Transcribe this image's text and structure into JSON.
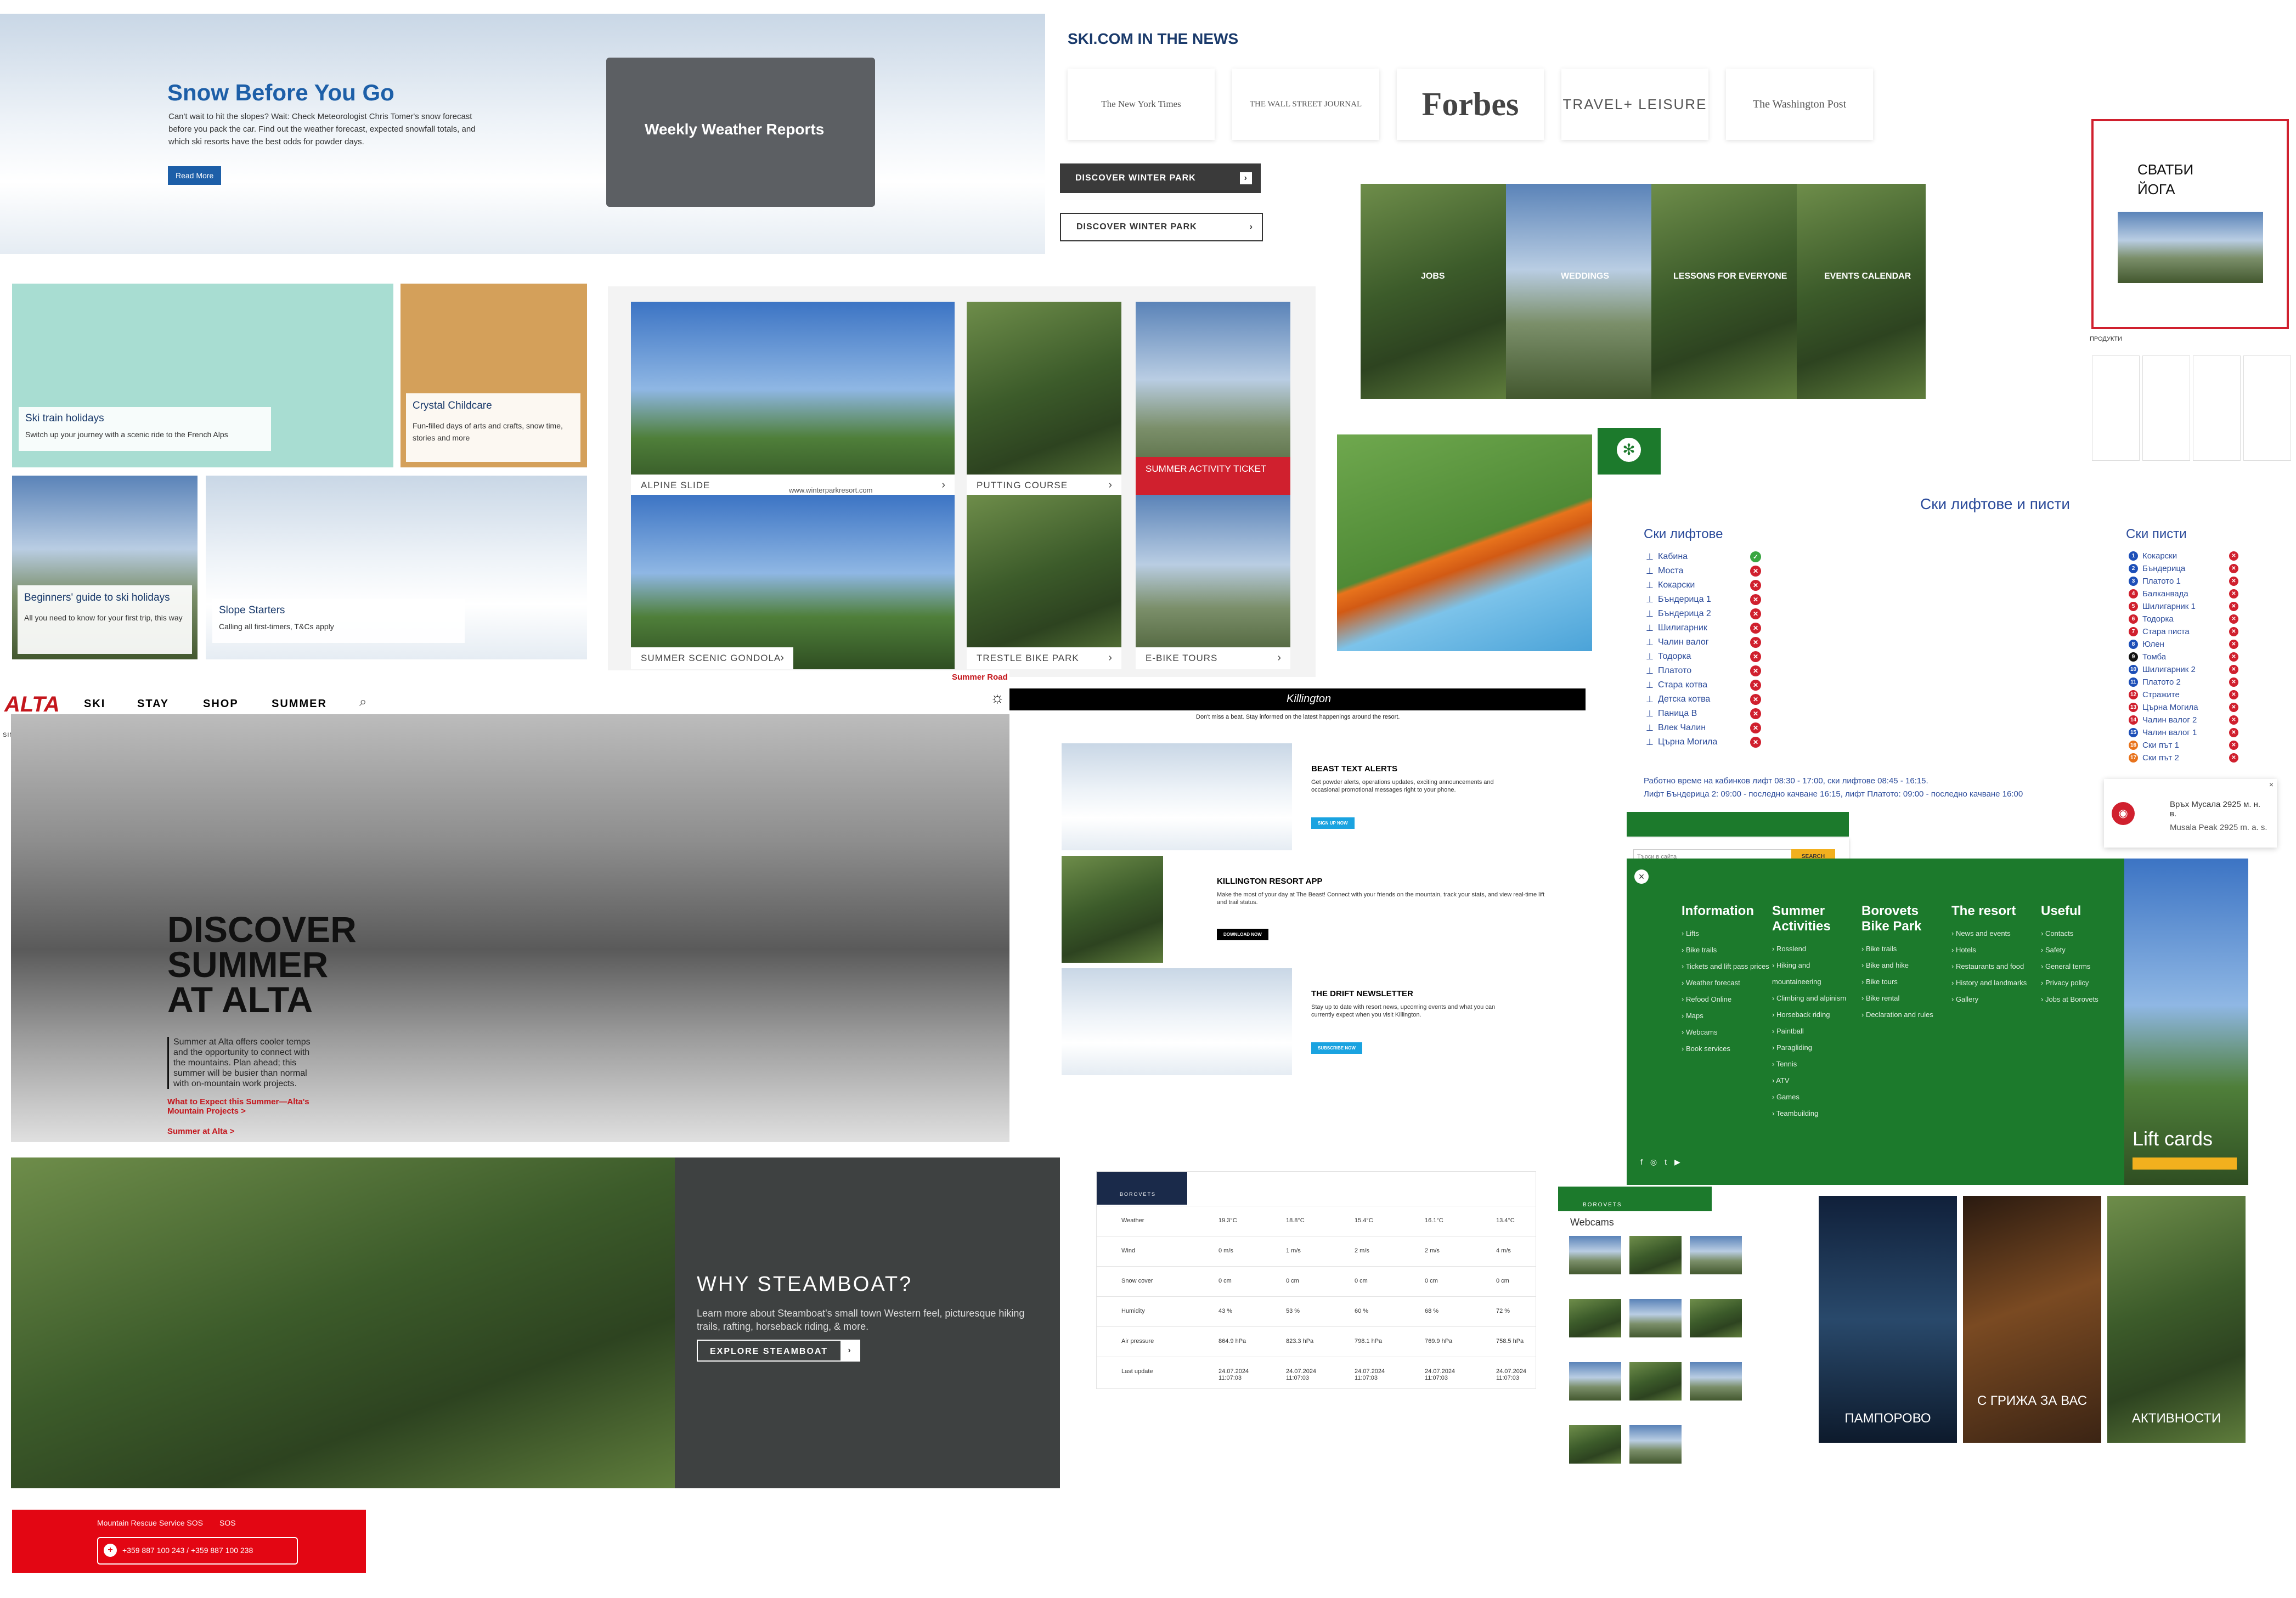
{
  "snow_banner": {
    "title": "Snow Before You Go",
    "body": "Can't wait to hit the slopes? Wait: Check Meteorologist Chris Tomer's snow forecast before you pack the car. Find out the weather forecast, expected snowfall totals, and which ski resorts have the best odds for powder days.",
    "button": "Read More",
    "card": "Weekly Weather Reports",
    "accent": "#1d5fa8"
  },
  "news": {
    "heading": "SKI.COM IN THE NEWS",
    "logos": [
      "The New York Times",
      "THE WALL STREET JOURNAL",
      "Forbes",
      "TRAVEL+ LEISURE",
      "The Washington Post"
    ]
  },
  "discover_buttons": [
    "DISCOVER WINTER PARK",
    "DISCOVER WINTER PARK"
  ],
  "green_activity": {
    "labels": [
      "JOBS",
      "WEDDINGS",
      "LESSONS FOR EVERYONE",
      "EVENTS CALENDAR"
    ]
  },
  "red_box": {
    "title": "СВАТБИ ЙОГА"
  },
  "products": {
    "heading": "ПРОДУКТИ"
  },
  "ski_holidays": {
    "tiles": [
      {
        "title": "Ski train holidays",
        "body": "Switch up your journey with a scenic ride to the French Alps"
      },
      {
        "title": "Crystal Childcare",
        "body": "Fun-filled days of arts and crafts, snow time, stories and more"
      },
      {
        "title": "Beginners' guide to ski holidays",
        "body": "All you need to know for your first trip, this way"
      },
      {
        "title": "Slope Starters",
        "body": "Calling all first-timers, T&Cs apply"
      }
    ]
  },
  "winter_park": {
    "tiles": [
      "ALPINE SLIDE",
      "PUTTING COURSE",
      "SUMMER ACTIVITY TICKET",
      "SUMMER SCENIC GONDOLA",
      "TRESTLE BIKE PARK",
      "E-BIKE TOURS"
    ],
    "url": "www.winterparkresort.com",
    "accent": "#d0202e"
  },
  "lifts": {
    "heading": "Ски лифтове и писти",
    "lifts_title": "Ски лифтове",
    "lifts": [
      {
        "name": "Кабина",
        "open": true
      },
      {
        "name": "Моста",
        "open": false
      },
      {
        "name": "Кокарски",
        "open": false
      },
      {
        "name": "Бъндерица 1",
        "open": false
      },
      {
        "name": "Бъндерица 2",
        "open": false
      },
      {
        "name": "Шилигарник",
        "open": false
      },
      {
        "name": "Чалин валог",
        "open": false
      },
      {
        "name": "Тодорка",
        "open": false
      },
      {
        "name": "Платото",
        "open": false
      },
      {
        "name": "Стара котва",
        "open": false
      },
      {
        "name": "Детска котва",
        "open": false
      },
      {
        "name": "Паница В",
        "open": false
      },
      {
        "name": "Влек Чалин",
        "open": false
      },
      {
        "name": "Църна Могила",
        "open": false
      }
    ],
    "runs_title": "Ски писти",
    "runs": [
      {
        "num": "1",
        "name": "Кокарски",
        "color": "#1d4fb8"
      },
      {
        "num": "2",
        "name": "Бъндерица",
        "color": "#1d4fb8"
      },
      {
        "num": "3",
        "name": "Платото 1",
        "color": "#1d4fb8"
      },
      {
        "num": "4",
        "name": "Балканвада",
        "color": "#d0202e"
      },
      {
        "num": "5",
        "name": "Шилигарник 1",
        "color": "#d0202e"
      },
      {
        "num": "6",
        "name": "Тодорка",
        "color": "#d0202e"
      },
      {
        "num": "7",
        "name": "Стара писта",
        "color": "#d0202e"
      },
      {
        "num": "8",
        "name": "Юлен",
        "color": "#1d4fb8"
      },
      {
        "num": "9",
        "name": "Томба",
        "color": "#111111"
      },
      {
        "num": "10",
        "name": "Шилигарник 2",
        "color": "#1d4fb8"
      },
      {
        "num": "11",
        "name": "Платото 2",
        "color": "#1d4fb8"
      },
      {
        "num": "12",
        "name": "Стражите",
        "color": "#d0202e"
      },
      {
        "num": "13",
        "name": "Църна Могила",
        "color": "#d0202e"
      },
      {
        "num": "14",
        "name": "Чалин валог 2",
        "color": "#d0202e"
      },
      {
        "num": "15",
        "name": "Чалин валог 1",
        "color": "#1d4fb8"
      },
      {
        "num": "16",
        "name": "Ски път 1",
        "color": "#e8731c"
      },
      {
        "num": "17",
        "name": "Ски път 2",
        "color": "#e8731c"
      }
    ],
    "hours_1": "Работно време на кабинков лифт 08:30 - 17:00, ски лифтове 08:45 - 16:15.",
    "hours_2": "Лифт Бъндерица 2: 09:00 - последно качване 16:15, лифт Платото: 09:00 - последно качване 16:00"
  },
  "musala": {
    "title": "Връх Мусала 2925 м. н. в.",
    "subtitle": "Musala Peak 2925 m. a. s."
  },
  "alta": {
    "logo": "ALTA",
    "since": "SINCE 1938",
    "nav": [
      "SKI",
      "STAY",
      "SHOP",
      "SUMMER"
    ],
    "road": "Summer Road",
    "title": "DISCOVER SUMMER AT ALTA",
    "body": "Summer at Alta offers cooler temps and the opportunity to connect with the mountains. Plan ahead; this summer will be busier than normal with on-mountain work projects.",
    "link1": "What to Expect this Summer—Alta's Mountain Projects >",
    "link2": "Summer at Alta >",
    "accent": "#c4161c"
  },
  "killington": {
    "logo": "Killington",
    "tagline": "Don't miss a beat. Stay informed on the latest happenings around the resort.",
    "items": [
      {
        "title": "BEAST TEXT ALERTS",
        "body": "Get powder alerts, operations updates, exciting announcements and occasional promotional messages right to your phone.",
        "button": "SIGN UP NOW"
      },
      {
        "title": "KILLINGTON RESORT APP",
        "body": "Make the most of your day at The Beast! Connect with your friends on the mountain, track your stats, and view real-time lift and trail status.",
        "button": "DOWNLOAD NOW"
      },
      {
        "title": "THE DRIFT NEWSLETTER",
        "body": "Stay up to date with resort news, upcoming events and what you can currently expect when you visit Killington.",
        "button": "SUBSCRIBE NOW"
      }
    ]
  },
  "borovets_footer": {
    "search_placeholder": "Търси в сайта",
    "search_button": "SEARCH",
    "columns": [
      {
        "title": "Information",
        "items": [
          "Lifts",
          "Bike trails",
          "Tickets and lift pass prices",
          "Weather forecast",
          "Refood Online",
          "Maps",
          "Webcams",
          "Book services"
        ]
      },
      {
        "title": "Summer Activities",
        "items": [
          "Rosslend",
          "Hiking and mountaineering",
          "Climbing and alpinism",
          "Horseback riding",
          "Paintball",
          "Paragliding",
          "Tennis",
          "ATV",
          "Games",
          "Teambuilding"
        ]
      },
      {
        "title": "Borovets Bike Park",
        "items": [
          "Bike trails",
          "Bike and hike",
          "Bike tours",
          "Bike rental",
          "Declaration and rules"
        ]
      },
      {
        "title": "The resort",
        "items": [
          "News and events",
          "Hotels",
          "Restaurants and food",
          "History and landmarks",
          "Gallery"
        ]
      },
      {
        "title": "Useful",
        "items": [
          "Contacts",
          "Safety",
          "General terms",
          "Privacy policy",
          "Jobs at Borovets"
        ]
      }
    ],
    "lift_cards": "Lift cards",
    "color": "#1c7a2c"
  },
  "steamboat": {
    "title": "WHY STEAMBOAT?",
    "body": "Learn more about Steamboat's small town Western feel, picturesque hiking trails, rafting, horseback riding, & more.",
    "button": "EXPLORE STEAMBOAT"
  },
  "weather_table": {
    "brand": "BOROVETS",
    "rows": [
      "Weather",
      "Wind",
      "Snow cover",
      "Humidity",
      "Air pressure",
      "Last update"
    ],
    "columns": [
      {
        "values": [
          "19.3°C",
          "0 m/s",
          "0 cm",
          "43 %",
          "864.9 hPa",
          "24.07.2024 11:07:03"
        ]
      },
      {
        "values": [
          "18.8°C",
          "1 m/s",
          "0 cm",
          "53 %",
          "823.3 hPa",
          "24.07.2024 11:07:03"
        ]
      },
      {
        "values": [
          "15.4°C",
          "2 m/s",
          "0 cm",
          "60 %",
          "798.1 hPa",
          "24.07.2024 11:07:03"
        ]
      },
      {
        "values": [
          "16.1°C",
          "2 m/s",
          "0 cm",
          "68 %",
          "769.9 hPa",
          "24.07.2024 11:07:03"
        ]
      },
      {
        "values": [
          "13.4°C",
          "4 m/s",
          "0 cm",
          "72 %",
          "758.5 hPa",
          "24.07.2024 11:07:03"
        ]
      }
    ]
  },
  "webcams": {
    "brand": "BOROVETS",
    "title": "Webcams"
  },
  "bg_tiles": [
    "ПАМПОРОВО",
    "С ГРИЖА ЗА ВАС",
    "АКТИВНОСТИ"
  ],
  "rescue": {
    "title": "Mountain Rescue Service SOS",
    "sos": "SOS",
    "phones": "+359 887 100 243 / +359 887 100 238",
    "color": "#e30613"
  }
}
